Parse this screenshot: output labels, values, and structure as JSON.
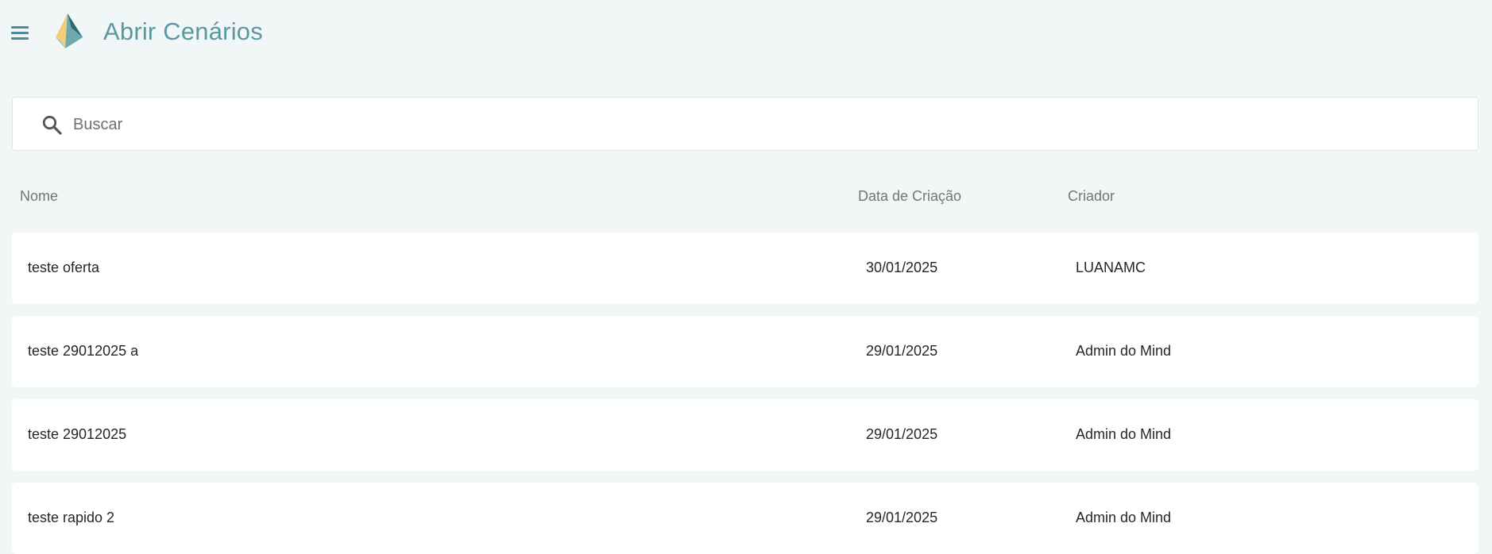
{
  "header": {
    "title": "Abrir Cenários",
    "menu_icon": "menu-icon",
    "logo_icon": "pyramid-logo",
    "accent_color": "#5a98a3"
  },
  "search": {
    "placeholder": "Buscar",
    "value": "",
    "icon": "search-icon"
  },
  "table": {
    "columns": [
      "Nome",
      "Data de Criação",
      "Criador"
    ],
    "rows": [
      {
        "nome": "teste oferta",
        "data": "30/01/2025",
        "criador": "LUANAMC"
      },
      {
        "nome": "teste 29012025 a",
        "data": "29/01/2025",
        "criador": "Admin do Mind"
      },
      {
        "nome": "teste 29012025",
        "data": "29/01/2025",
        "criador": "Admin do Mind"
      },
      {
        "nome": "teste rapido 2",
        "data": "29/01/2025",
        "criador": "Admin do Mind"
      }
    ]
  }
}
